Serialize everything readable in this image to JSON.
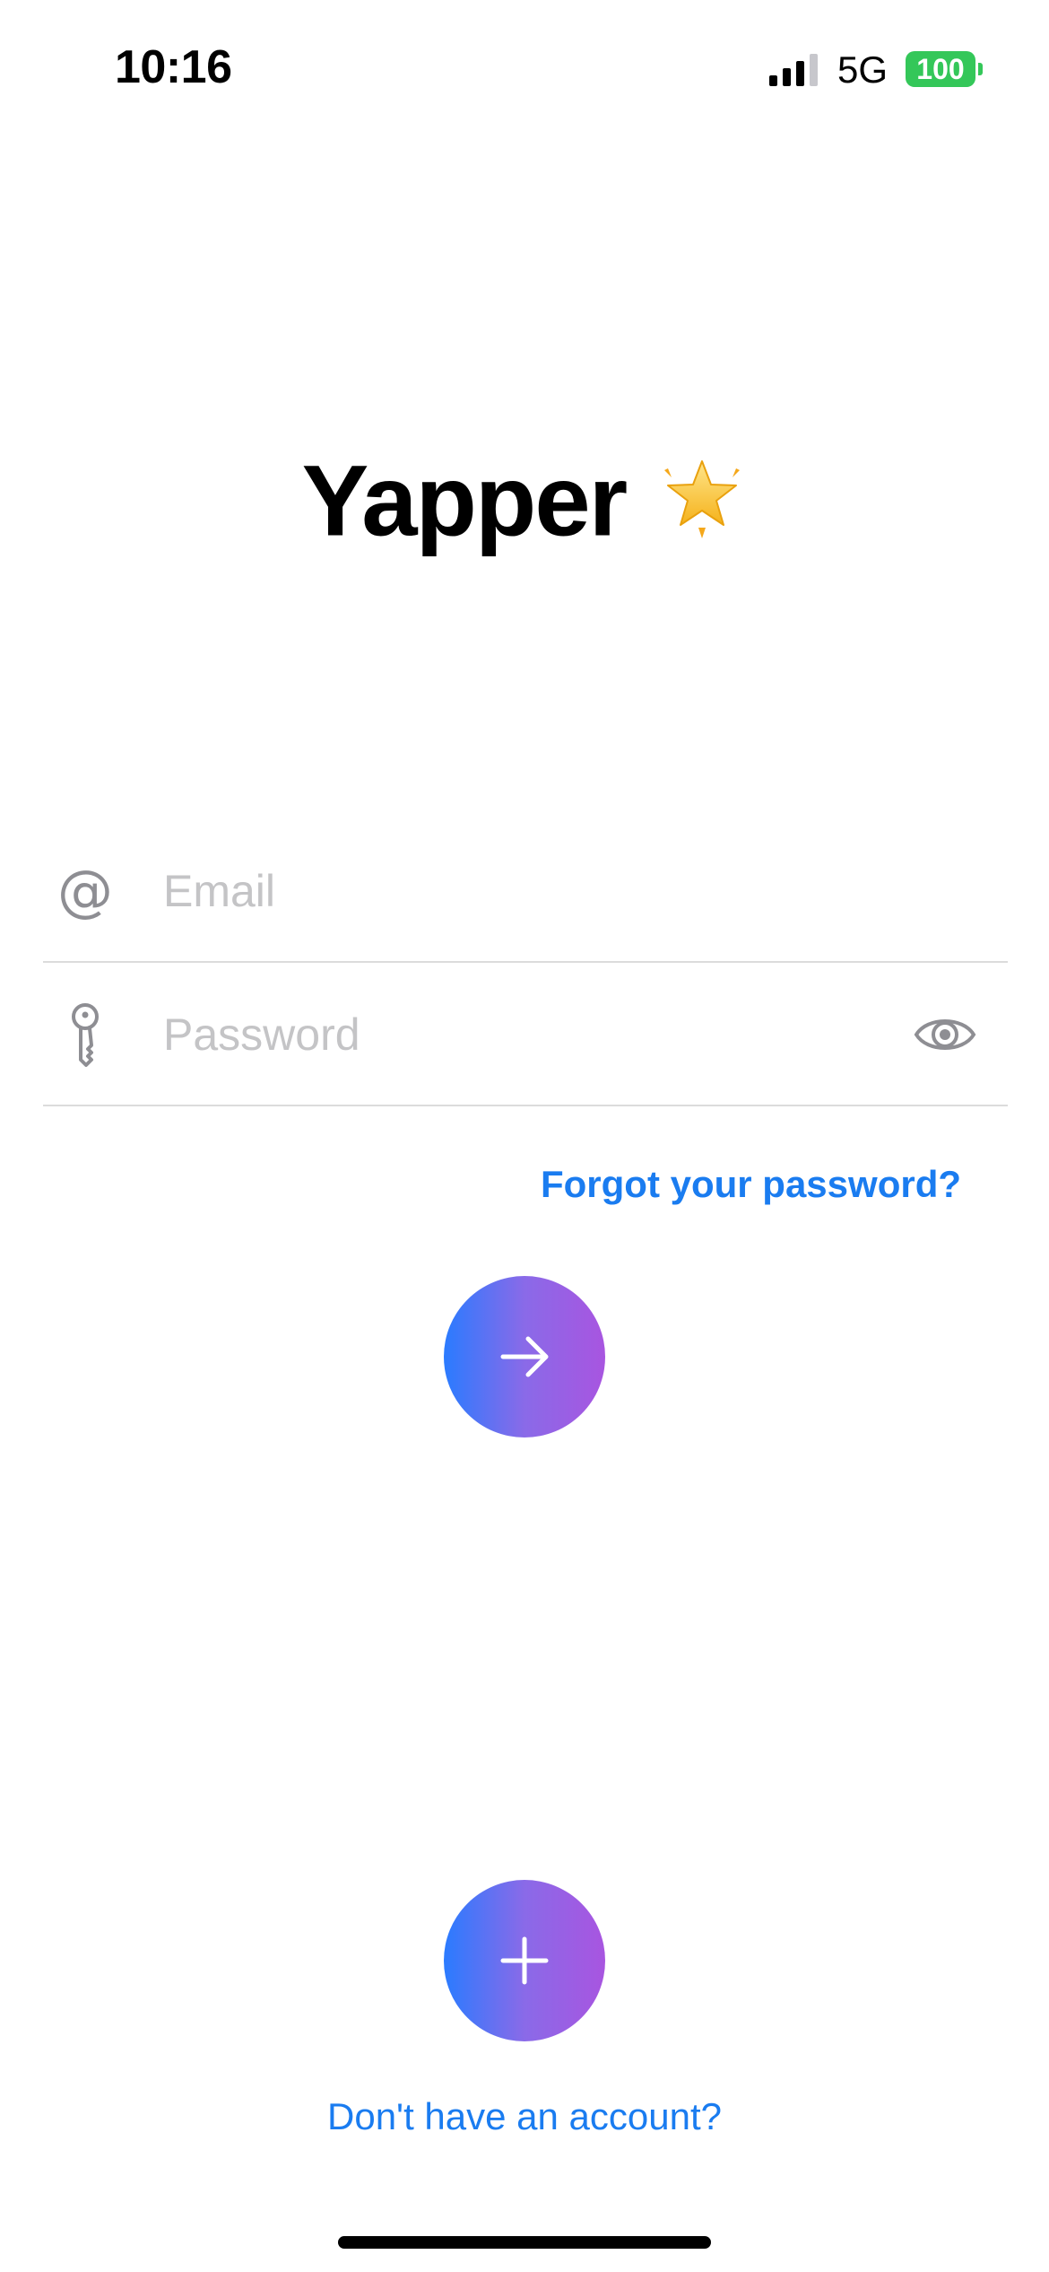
{
  "status_bar": {
    "time": "10:16",
    "network": "5G",
    "battery_level": "100",
    "battery_color": "#34c759",
    "signal_icon": "cellular-signal-icon"
  },
  "app": {
    "title": "Yapper",
    "title_icon": "star-icon"
  },
  "form": {
    "email": {
      "icon": "at-sign-icon",
      "placeholder": "Email",
      "value": ""
    },
    "password": {
      "icon": "key-icon",
      "placeholder": "Password",
      "value": "",
      "toggle_icon": "eye-icon"
    },
    "forgot_password_label": "Forgot your password?",
    "submit_icon": "arrow-right-icon"
  },
  "signup": {
    "button_icon": "plus-icon",
    "link_label": "Don't have an account?"
  },
  "colors": {
    "accent": "#1a7cf0",
    "gradient_start": "#2a7bff",
    "gradient_end": "#a855e0",
    "placeholder": "#c4c4c6",
    "icon_gray": "#8e8e93"
  }
}
